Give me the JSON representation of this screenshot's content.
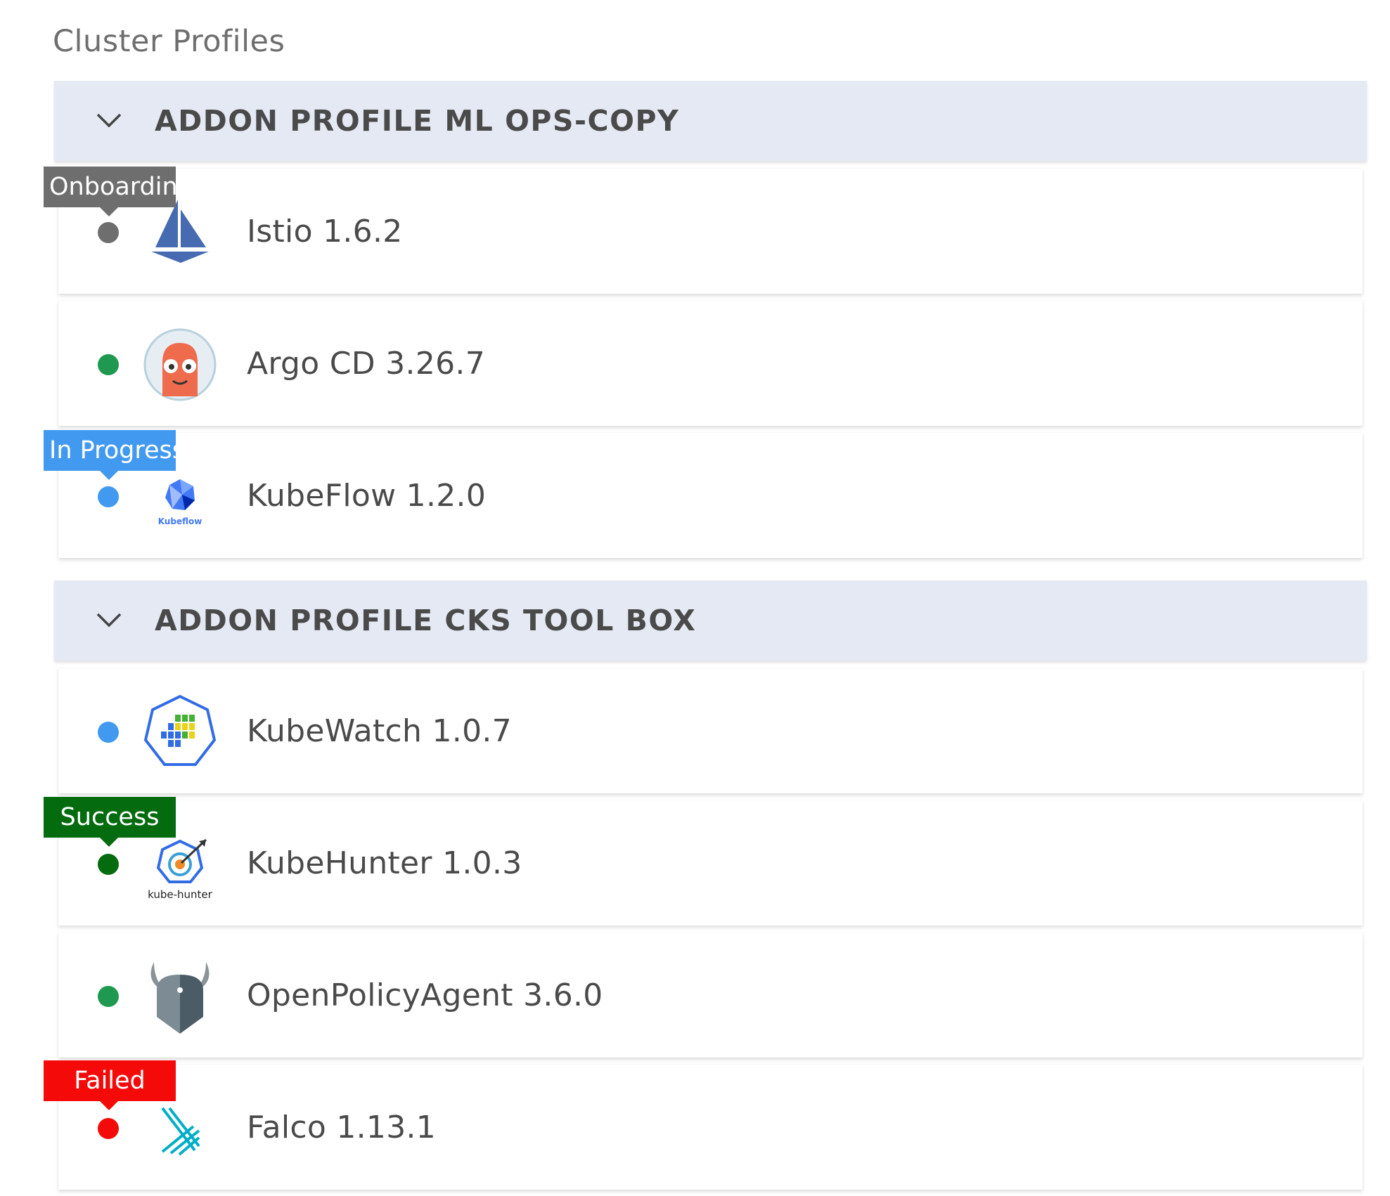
{
  "page": {
    "title": "Cluster Profiles"
  },
  "colors": {
    "onboarding": "#6e6e6e",
    "in_progress": "#4299f0",
    "success": "#046b0f",
    "failed": "#f50a0a",
    "healthy_green": "#1f9850",
    "header_bg": "#e4e9f4"
  },
  "groups": [
    {
      "title": "ADDON PROFILE ML OPS-COPY",
      "expanded": true,
      "items": [
        {
          "label": "Istio 1.6.2",
          "icon": "istio-sail-icon",
          "status": "onboarding",
          "tooltip": "Onboarding"
        },
        {
          "label": "Argo CD 3.26.7",
          "icon": "argo-cd-icon",
          "status": "healthy",
          "tooltip": null
        },
        {
          "label": "KubeFlow 1.2.0",
          "icon": "kubeflow-icon",
          "status": "in_progress",
          "tooltip": "In Progress",
          "logo_text": "Kubeflow"
        }
      ]
    },
    {
      "title": "ADDON PROFILE CKS TOOL BOX",
      "expanded": true,
      "items": [
        {
          "label": "KubeWatch 1.0.7",
          "icon": "kubewatch-icon",
          "status": "in_progress",
          "tooltip": null
        },
        {
          "label": "KubeHunter 1.0.3",
          "icon": "kube-hunter-icon",
          "status": "success",
          "tooltip": "Success",
          "logo_text": "kube-hunter"
        },
        {
          "label": "OpenPolicyAgent 3.6.0",
          "icon": "opa-icon",
          "status": "healthy",
          "tooltip": null
        },
        {
          "label": "Falco 1.13.1",
          "icon": "falco-icon",
          "status": "failed",
          "tooltip": "Failed"
        }
      ]
    }
  ]
}
